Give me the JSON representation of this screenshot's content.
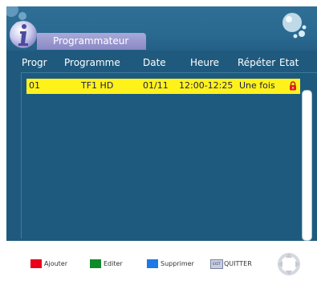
{
  "header": {
    "title": "Programmateur"
  },
  "columns": {
    "progr": "Progr",
    "programme": "Programme",
    "date": "Date",
    "heure": "Heure",
    "repeter": "Répéter",
    "etat": "Etat"
  },
  "rows": [
    {
      "progr": "01",
      "programme": "TF1 HD",
      "date": "01/11",
      "heure": "12:00-12:25",
      "repeter": "Une fois",
      "etat_icon": "lock-icon",
      "highlight_color": "#fff21a"
    }
  ],
  "footer": {
    "ajouter": {
      "label": "Ajouter",
      "color": "#e8001c"
    },
    "editer": {
      "label": "Editer",
      "color": "#0e8a2a"
    },
    "supprimer": {
      "label": "Supprimer",
      "color": "#1e78e6"
    },
    "quitter": {
      "label": "QUITTER",
      "key_label": "EXIT"
    }
  },
  "colors": {
    "background": "#1f5a7e",
    "header_band": "#2a6a91",
    "title_tab": "#9a99d0"
  }
}
